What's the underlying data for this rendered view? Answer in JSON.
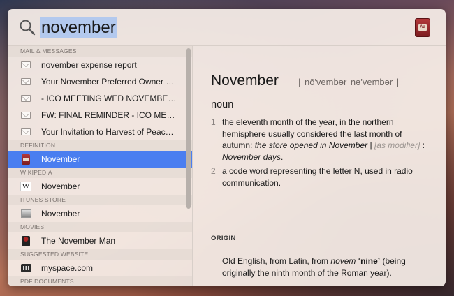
{
  "search": {
    "query": "november"
  },
  "sections": [
    {
      "header": "MAIL & MESSAGES",
      "items": [
        {
          "icon": "mail-icon",
          "label": "november expense report"
        },
        {
          "icon": "mail-icon",
          "label": "Your November Preferred Owner Pr..."
        },
        {
          "icon": "mail-icon",
          "label": "- ICO MEETING WED NOVEMBER 1..."
        },
        {
          "icon": "mail-icon",
          "label": "FW: FINAL REMINDER - ICO MEETI..."
        },
        {
          "icon": "mail-icon",
          "label": "Your Invitation to Harvest of Peace,..."
        }
      ]
    },
    {
      "header": "DEFINITION",
      "items": [
        {
          "icon": "dictionary-icon",
          "label": "November",
          "selected": true
        }
      ]
    },
    {
      "header": "WIKIPEDIA",
      "items": [
        {
          "icon": "wikipedia-icon",
          "label": "November"
        }
      ]
    },
    {
      "header": "ITUNES STORE",
      "items": [
        {
          "icon": "itunes-icon",
          "label": "November"
        }
      ]
    },
    {
      "header": "MOVIES",
      "items": [
        {
          "icon": "movie-icon",
          "label": "The November Man"
        }
      ]
    },
    {
      "header": "SUGGESTED WEBSITE",
      "items": [
        {
          "icon": "website-icon",
          "label": "myspace.com"
        }
      ]
    },
    {
      "header": "PDF DOCUMENTS",
      "items": []
    }
  ],
  "definition": {
    "word": "November",
    "pronunciation": "| nō'vembər   nə'vembər |",
    "part_of_speech": "noun",
    "senses": [
      {
        "num": "1",
        "text": "the eleventh month of the year, in the northern hemisphere usually considered the last month of autumn: ",
        "example": "the store opened in November",
        "sep": " | ",
        "register": "[as modifier]",
        "sep2": " : ",
        "example2": "November days",
        "end": "."
      },
      {
        "num": "2",
        "text": "a code word representing the letter N, used in radio communication."
      }
    ],
    "origin_header": "ORIGIN",
    "origin": {
      "pre": "Old English, from Latin, from ",
      "latin": "novem",
      "gloss": "‘nine’",
      "post": " (being originally the ninth month of the Roman year)."
    }
  },
  "colors": {
    "selection": "#4a7ef0",
    "query_highlight": "#b3c9ee"
  }
}
